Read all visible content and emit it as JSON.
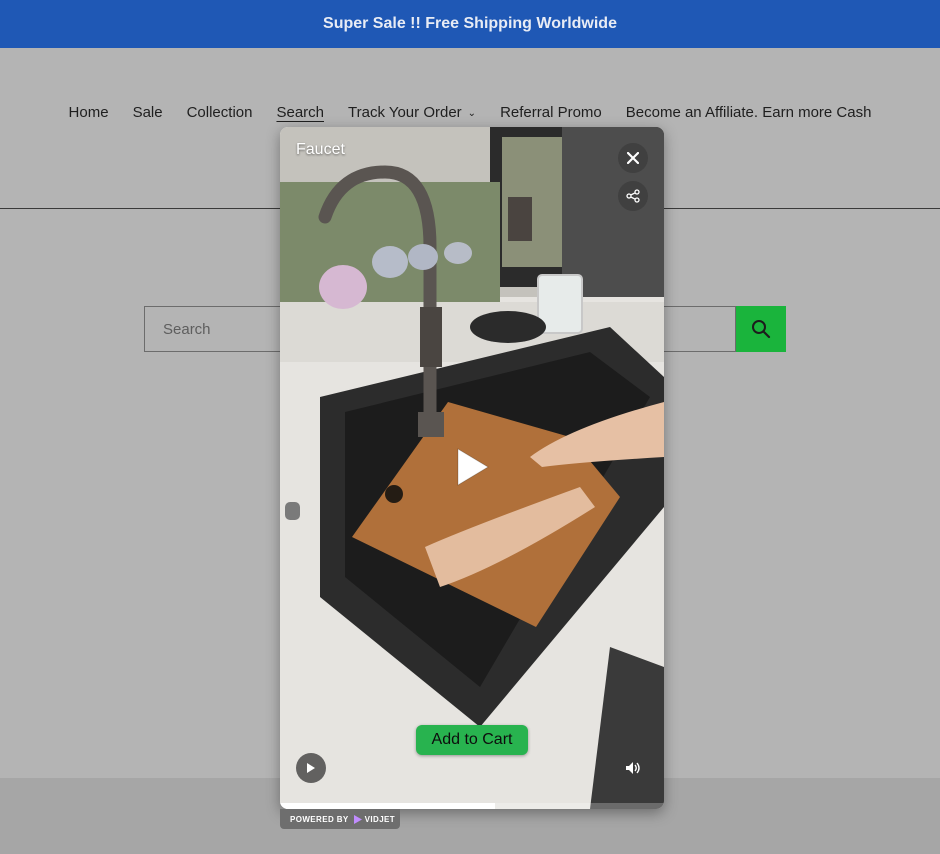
{
  "announcement": "Super Sale !! Free Shipping Worldwide",
  "nav": {
    "items": [
      {
        "label": "Home"
      },
      {
        "label": "Sale"
      },
      {
        "label": "Collection"
      },
      {
        "label": "Search",
        "active": true
      },
      {
        "label": "Track Your Order",
        "has_dropdown": true
      },
      {
        "label": "Referral Promo"
      },
      {
        "label": "Become an Affiliate. Earn more Cash"
      }
    ]
  },
  "search": {
    "placeholder": "Search",
    "value": "",
    "button_icon": "search-icon",
    "button_color": "#1ab43c"
  },
  "video_popup": {
    "title": "Faucet",
    "close_icon": "close-icon",
    "share_icon": "share-icon",
    "play_icon": "play-icon",
    "cta_label": "Add to Cart",
    "cta_color": "#28b34f",
    "volume_icon": "volume-icon",
    "progress": 0.56
  },
  "powered_by": {
    "prefix": "POWERED BY",
    "brand": "VIDJET"
  },
  "colors": {
    "announcement_bg": "#1f58b5",
    "page_bg": "#b4b4b4"
  }
}
